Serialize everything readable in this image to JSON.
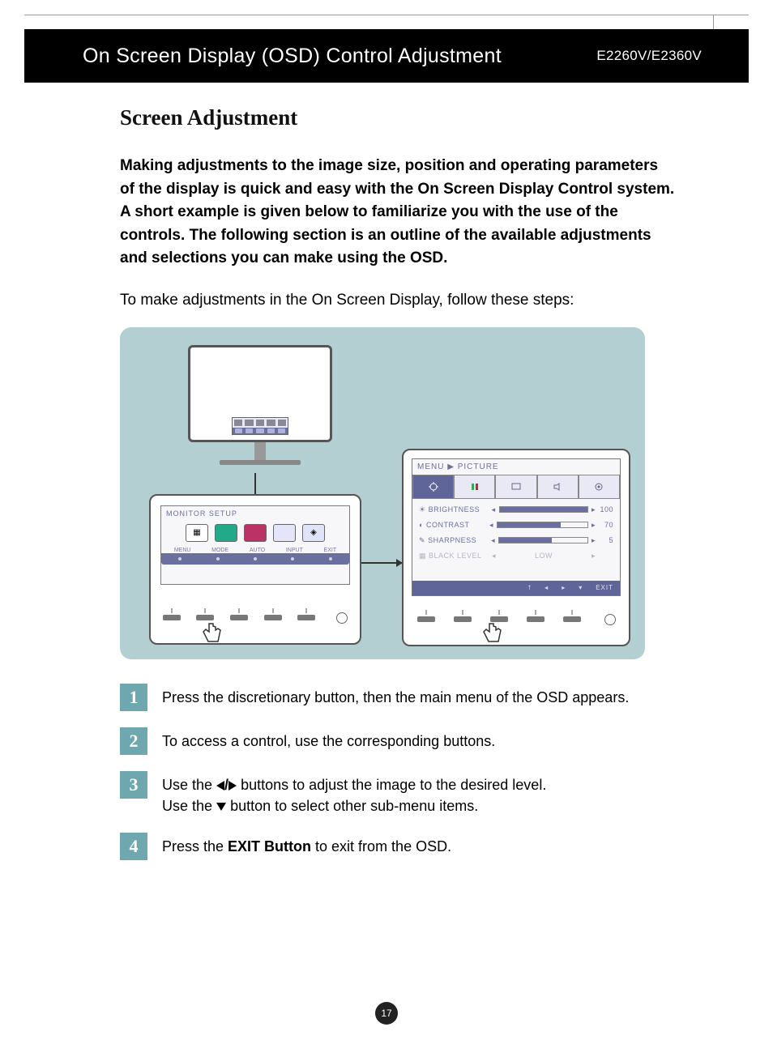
{
  "header": {
    "title": "On Screen Display (OSD) Control Adjustment",
    "model": "E2260V/E2360V"
  },
  "section": {
    "title": "Screen Adjustment",
    "intro": "Making adjustments to the image size, position and operating parameters of the display is quick and easy with the On Screen Display Control system.\nA short example is given below to familiarize you with the use of the controls. The following section is an outline of the available adjustments and selections you can make using the OSD.",
    "lead": "To make adjustments in the On Screen Display, follow these steps:"
  },
  "osd": {
    "panelA_title": "MONITOR SETUP",
    "panelA_labels": [
      "MENU",
      "MODE",
      "AUTO",
      "INPUT",
      "EXIT"
    ],
    "panelB_title": "MENU ▶ PICTURE",
    "panelB_rows": [
      {
        "label": "BRIGHTNESS",
        "value": "100",
        "fill": 100
      },
      {
        "label": "CONTRAST",
        "value": "70",
        "fill": 70
      },
      {
        "label": "SHARPNESS",
        "value": "5",
        "fill": 60
      }
    ],
    "panelB_disabled": {
      "label": "BLACK LEVEL",
      "value": "LOW"
    },
    "panelB_footer_exit": "EXIT"
  },
  "steps": [
    {
      "n": "1",
      "text": "Press the discretionary button, then the main menu of the OSD appears."
    },
    {
      "n": "2",
      "text": "To access a control, use the corresponding buttons."
    },
    {
      "n": "3",
      "text_a": "Use the  ",
      "text_b": "  buttons to adjust the image to the desired level.",
      "text_c": "Use the ",
      "text_d": "  button to select other sub-menu items."
    },
    {
      "n": "4",
      "text_a": "Press the ",
      "bold": "EXIT Button",
      "text_b": " to exit from the OSD."
    }
  ],
  "page_number": "17"
}
